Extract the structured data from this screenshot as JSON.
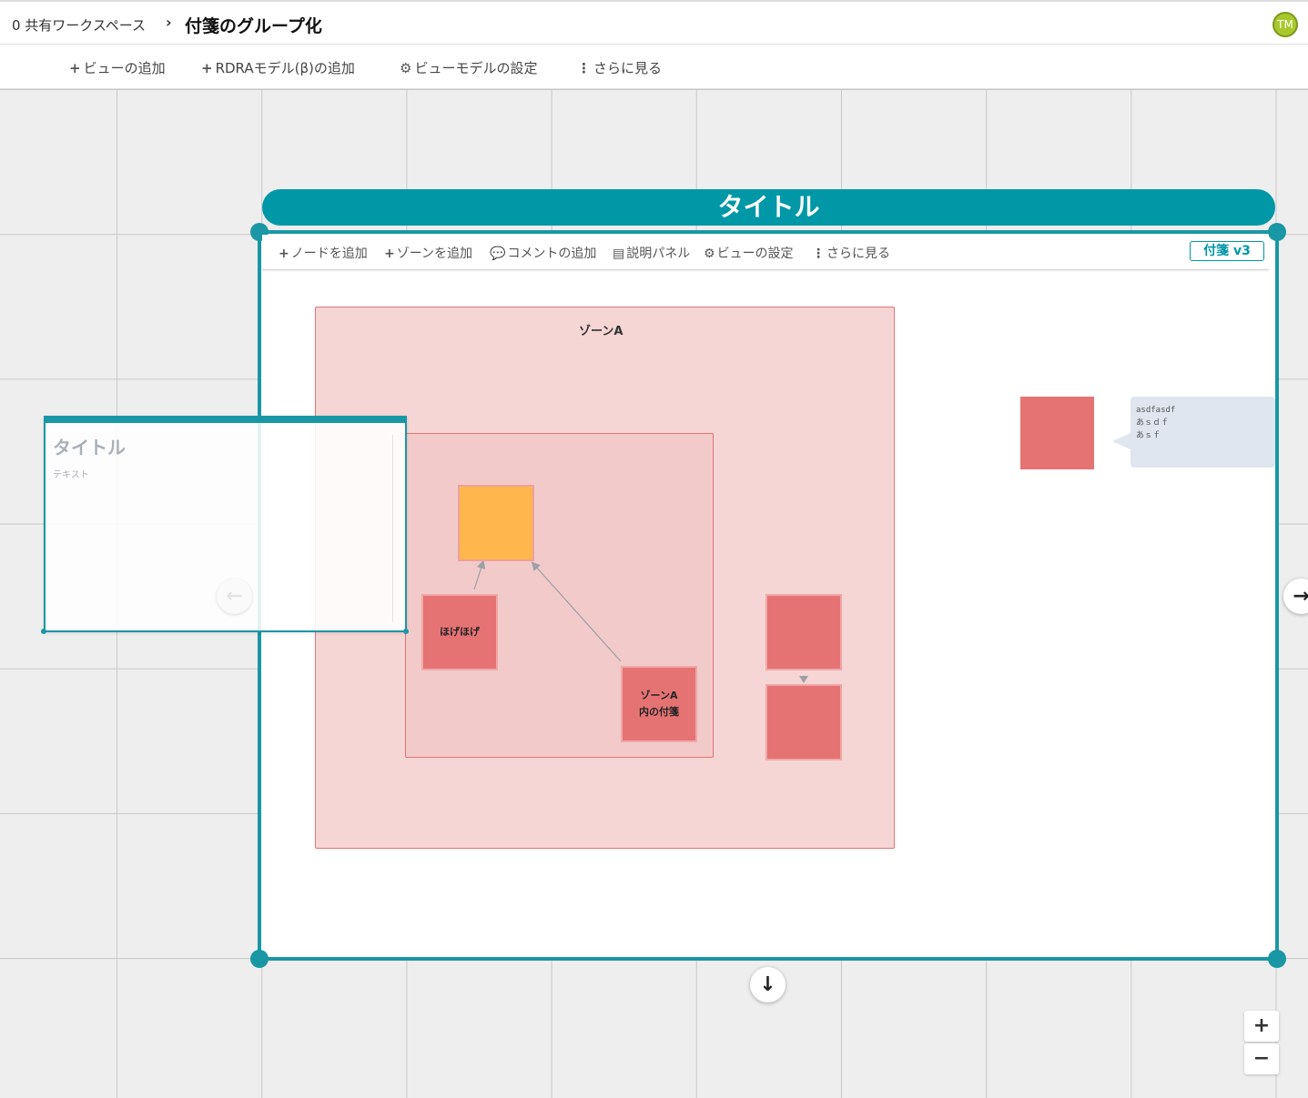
{
  "header": {
    "workspace_label": "0 共有ワークスペース",
    "separator": "›",
    "page_title": "付箋のグループ化",
    "avatar_initials": "TM"
  },
  "toolbar": {
    "add_view": "ビューの追加",
    "add_rdra_model": "RDRAモデル(β)の追加",
    "view_model_settings": "ビューモデルの設定",
    "more": "さらに見る"
  },
  "view": {
    "title": "タイトル",
    "toolbar": {
      "add_node": "ノードを追加",
      "add_zone": "ゾーンを追加",
      "add_comment": "コメントの追加",
      "description_panel": "説明パネル",
      "view_settings": "ビューの設定",
      "more": "さらに見る"
    },
    "badge": "付箋 v3",
    "zone_a_label": "ゾーンA",
    "stickies": {
      "hogehoge": "ほげほげ",
      "zone_a_sticky_line1": "ゾーンA",
      "zone_a_sticky_line2": "内の付箋"
    },
    "comment": {
      "line1": "asdfasdf",
      "line2": "あｓｄｆ",
      "line3": "あｓｆ"
    }
  },
  "side_panel": {
    "title": "タイトル",
    "text": "テキスト"
  },
  "colors": {
    "accent": "#0097a7",
    "sticky_red": "#e57373",
    "sticky_orange": "#ffb74d",
    "zone_fill": "#f6d5d5"
  },
  "icons": [
    "plus-icon",
    "gear-icon",
    "vertical-ellipsis-icon",
    "comments-icon",
    "document-icon",
    "arrow-left-icon",
    "arrow-right-icon",
    "arrow-down-icon",
    "zoom-in-icon",
    "zoom-out-icon"
  ]
}
